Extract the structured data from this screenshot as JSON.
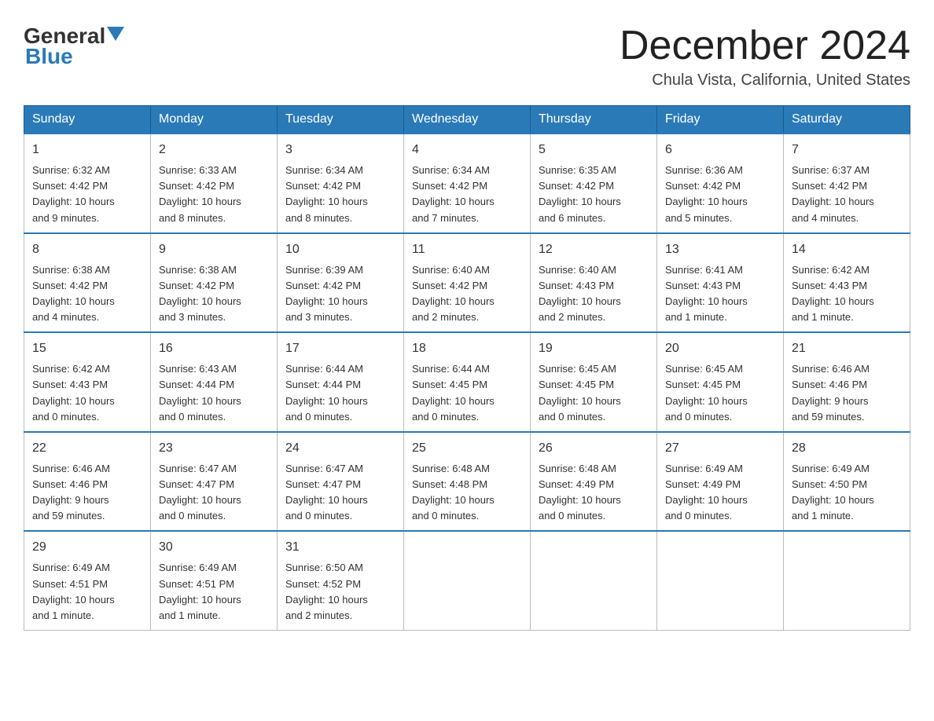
{
  "header": {
    "logo_text1": "General",
    "logo_text2": "Blue",
    "month": "December 2024",
    "location": "Chula Vista, California, United States"
  },
  "weekdays": [
    "Sunday",
    "Monday",
    "Tuesday",
    "Wednesday",
    "Thursday",
    "Friday",
    "Saturday"
  ],
  "weeks": [
    [
      {
        "day": "1",
        "sunrise": "6:32 AM",
        "sunset": "4:42 PM",
        "daylight": "10 hours and 9 minutes."
      },
      {
        "day": "2",
        "sunrise": "6:33 AM",
        "sunset": "4:42 PM",
        "daylight": "10 hours and 8 minutes."
      },
      {
        "day": "3",
        "sunrise": "6:34 AM",
        "sunset": "4:42 PM",
        "daylight": "10 hours and 8 minutes."
      },
      {
        "day": "4",
        "sunrise": "6:34 AM",
        "sunset": "4:42 PM",
        "daylight": "10 hours and 7 minutes."
      },
      {
        "day": "5",
        "sunrise": "6:35 AM",
        "sunset": "4:42 PM",
        "daylight": "10 hours and 6 minutes."
      },
      {
        "day": "6",
        "sunrise": "6:36 AM",
        "sunset": "4:42 PM",
        "daylight": "10 hours and 5 minutes."
      },
      {
        "day": "7",
        "sunrise": "6:37 AM",
        "sunset": "4:42 PM",
        "daylight": "10 hours and 4 minutes."
      }
    ],
    [
      {
        "day": "8",
        "sunrise": "6:38 AM",
        "sunset": "4:42 PM",
        "daylight": "10 hours and 4 minutes."
      },
      {
        "day": "9",
        "sunrise": "6:38 AM",
        "sunset": "4:42 PM",
        "daylight": "10 hours and 3 minutes."
      },
      {
        "day": "10",
        "sunrise": "6:39 AM",
        "sunset": "4:42 PM",
        "daylight": "10 hours and 3 minutes."
      },
      {
        "day": "11",
        "sunrise": "6:40 AM",
        "sunset": "4:42 PM",
        "daylight": "10 hours and 2 minutes."
      },
      {
        "day": "12",
        "sunrise": "6:40 AM",
        "sunset": "4:43 PM",
        "daylight": "10 hours and 2 minutes."
      },
      {
        "day": "13",
        "sunrise": "6:41 AM",
        "sunset": "4:43 PM",
        "daylight": "10 hours and 1 minute."
      },
      {
        "day": "14",
        "sunrise": "6:42 AM",
        "sunset": "4:43 PM",
        "daylight": "10 hours and 1 minute."
      }
    ],
    [
      {
        "day": "15",
        "sunrise": "6:42 AM",
        "sunset": "4:43 PM",
        "daylight": "10 hours and 0 minutes."
      },
      {
        "day": "16",
        "sunrise": "6:43 AM",
        "sunset": "4:44 PM",
        "daylight": "10 hours and 0 minutes."
      },
      {
        "day": "17",
        "sunrise": "6:44 AM",
        "sunset": "4:44 PM",
        "daylight": "10 hours and 0 minutes."
      },
      {
        "day": "18",
        "sunrise": "6:44 AM",
        "sunset": "4:45 PM",
        "daylight": "10 hours and 0 minutes."
      },
      {
        "day": "19",
        "sunrise": "6:45 AM",
        "sunset": "4:45 PM",
        "daylight": "10 hours and 0 minutes."
      },
      {
        "day": "20",
        "sunrise": "6:45 AM",
        "sunset": "4:45 PM",
        "daylight": "10 hours and 0 minutes."
      },
      {
        "day": "21",
        "sunrise": "6:46 AM",
        "sunset": "4:46 PM",
        "daylight": "9 hours and 59 minutes."
      }
    ],
    [
      {
        "day": "22",
        "sunrise": "6:46 AM",
        "sunset": "4:46 PM",
        "daylight": "9 hours and 59 minutes."
      },
      {
        "day": "23",
        "sunrise": "6:47 AM",
        "sunset": "4:47 PM",
        "daylight": "10 hours and 0 minutes."
      },
      {
        "day": "24",
        "sunrise": "6:47 AM",
        "sunset": "4:47 PM",
        "daylight": "10 hours and 0 minutes."
      },
      {
        "day": "25",
        "sunrise": "6:48 AM",
        "sunset": "4:48 PM",
        "daylight": "10 hours and 0 minutes."
      },
      {
        "day": "26",
        "sunrise": "6:48 AM",
        "sunset": "4:49 PM",
        "daylight": "10 hours and 0 minutes."
      },
      {
        "day": "27",
        "sunrise": "6:49 AM",
        "sunset": "4:49 PM",
        "daylight": "10 hours and 0 minutes."
      },
      {
        "day": "28",
        "sunrise": "6:49 AM",
        "sunset": "4:50 PM",
        "daylight": "10 hours and 1 minute."
      }
    ],
    [
      {
        "day": "29",
        "sunrise": "6:49 AM",
        "sunset": "4:51 PM",
        "daylight": "10 hours and 1 minute."
      },
      {
        "day": "30",
        "sunrise": "6:49 AM",
        "sunset": "4:51 PM",
        "daylight": "10 hours and 1 minute."
      },
      {
        "day": "31",
        "sunrise": "6:50 AM",
        "sunset": "4:52 PM",
        "daylight": "10 hours and 2 minutes."
      },
      null,
      null,
      null,
      null
    ]
  ],
  "labels": {
    "sunrise": "Sunrise:",
    "sunset": "Sunset:",
    "daylight": "Daylight:"
  }
}
